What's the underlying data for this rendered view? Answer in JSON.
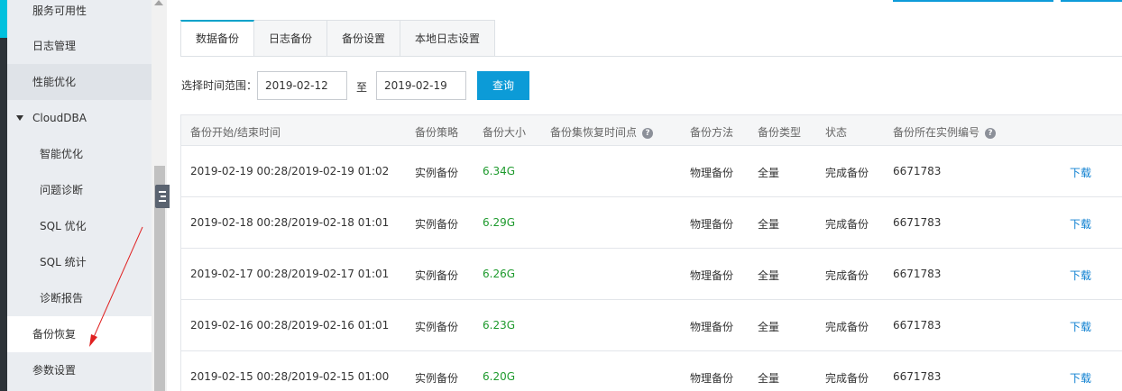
{
  "sidebar": {
    "items": [
      {
        "label": "服务可用性"
      },
      {
        "label": "日志管理"
      },
      {
        "label": "性能优化"
      },
      {
        "label": "CloudDBA"
      },
      {
        "label": "智能优化"
      },
      {
        "label": "问题诊断"
      },
      {
        "label": "SQL 优化"
      },
      {
        "label": "SQL 统计"
      },
      {
        "label": "诊断报告"
      },
      {
        "label": "备份恢复"
      },
      {
        "label": "参数设置"
      }
    ]
  },
  "tabs": [
    {
      "label": "数据备份"
    },
    {
      "label": "日志备份"
    },
    {
      "label": "备份设置"
    },
    {
      "label": "本地日志设置"
    }
  ],
  "filter": {
    "range_label": "选择时间范围：",
    "start_date": "2019-02-12",
    "to_label": "至",
    "end_date": "2019-02-19",
    "query_label": "查询"
  },
  "table": {
    "headers": {
      "time": "备份开始/结束时间",
      "strategy": "备份策略",
      "size": "备份大小",
      "restore_point": "备份集恢复时间点",
      "method": "备份方法",
      "type": "备份类型",
      "status": "状态",
      "instance": "备份所在实例编号"
    },
    "rows": [
      {
        "time": "2019-02-19 00:28/2019-02-19 01:02",
        "strategy": "实例备份",
        "size": "6.34G",
        "method": "物理备份",
        "type": "全量",
        "status": "完成备份",
        "instance": "6671783",
        "action": "下载"
      },
      {
        "time": "2019-02-18 00:28/2019-02-18 01:01",
        "strategy": "实例备份",
        "size": "6.29G",
        "method": "物理备份",
        "type": "全量",
        "status": "完成备份",
        "instance": "6671783",
        "action": "下载"
      },
      {
        "time": "2019-02-17 00:28/2019-02-17 01:01",
        "strategy": "实例备份",
        "size": "6.26G",
        "method": "物理备份",
        "type": "全量",
        "status": "完成备份",
        "instance": "6671783",
        "action": "下载"
      },
      {
        "time": "2019-02-16 00:28/2019-02-16 01:01",
        "strategy": "实例备份",
        "size": "6.23G",
        "method": "物理备份",
        "type": "全量",
        "status": "完成备份",
        "instance": "6671783",
        "action": "下载"
      },
      {
        "time": "2019-02-15 00:28/2019-02-15 01:00",
        "strategy": "实例备份",
        "size": "6.20G",
        "method": "物理备份",
        "type": "全量",
        "status": "完成备份",
        "instance": "6671783",
        "action": "下载"
      }
    ]
  },
  "colors": {
    "accent": "#00a2ca",
    "button": "#0c9bd7",
    "size_text": "#1e9a2d",
    "link": "#0c7fd0",
    "annotation": "#e02020"
  },
  "icons": [
    "caret-down-icon",
    "help-circle-icon",
    "collapse-menu-icon",
    "scroll-up-icon"
  ]
}
